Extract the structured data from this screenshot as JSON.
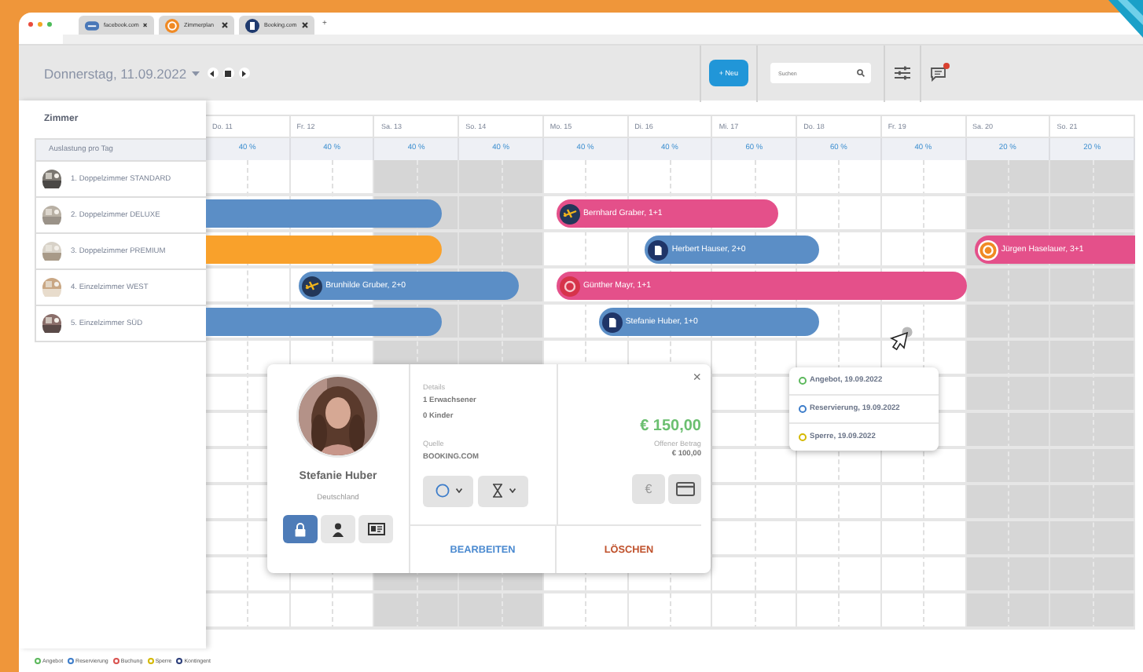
{
  "browser": {
    "tabs": [
      {
        "label": "facebook.com",
        "kind": "web"
      },
      {
        "label": "Zimmerplan",
        "kind": "planner"
      },
      {
        "label": "Booking.com",
        "kind": "booking"
      }
    ],
    "new_tab": "+"
  },
  "toolbar": {
    "date": "Donnerstag, 11.09.2022",
    "new_button": "+ Neu",
    "search": {
      "placeholder": "Suchen"
    },
    "unread": true
  },
  "rooms": {
    "title": "Zimmer",
    "occupancy_label": "Auslastung pro Tag",
    "items": [
      {
        "name": "1. Doppelzimmer STANDARD"
      },
      {
        "name": "2. Doppelzimmer DELUXE",
        "bookings": [
          {
            "kind": "continued",
            "color": "#5b8ec6"
          },
          {
            "guest": "Bernhard Graber, 1+1",
            "kind": "airline",
            "color": "#e4508a"
          }
        ]
      },
      {
        "name": "3. Doppelzimmer PREMIUM",
        "bookings": [
          {
            "kind": "continued",
            "color": "#f9a12b"
          },
          {
            "guest": "Herbert Hauser, 2+0",
            "kind": "booking",
            "color": "#5b8ec6"
          },
          {
            "guest": "Jürgen Haselauer, 3+1",
            "kind": "planner",
            "color": "#e4508a"
          }
        ]
      },
      {
        "name": "4. Einzelzimmer WEST",
        "bookings": [
          {
            "guest": "Brunhilde Gruber, 2+0",
            "kind": "airline",
            "color": "#5b8ec6"
          },
          {
            "guest": "Günther Mayr, 1+1",
            "kind": "other",
            "color": "#e4508a"
          }
        ]
      },
      {
        "name": "5. Einzelzimmer SÜD",
        "bookings": [
          {
            "kind": "continued",
            "color": "#5b8ec6"
          },
          {
            "guest": "Stefanie Huber, 1+0",
            "kind": "booking",
            "color": "#5b8ec6"
          }
        ]
      }
    ]
  },
  "days": [
    {
      "label": "Do. 11",
      "occupancy": "40 %",
      "weekend": false
    },
    {
      "label": "Fr. 12",
      "occupancy": "40 %",
      "weekend": false
    },
    {
      "label": "Sa. 13",
      "occupancy": "40 %",
      "weekend": true
    },
    {
      "label": "So. 14",
      "occupancy": "40 %",
      "weekend": true
    },
    {
      "label": "Mo. 15",
      "occupancy": "40 %",
      "weekend": false
    },
    {
      "label": "Di. 16",
      "occupancy": "40 %",
      "weekend": false
    },
    {
      "label": "Mi. 17",
      "occupancy": "60 %",
      "weekend": false
    },
    {
      "label": "Do. 18",
      "occupancy": "60 %",
      "weekend": false
    },
    {
      "label": "Fr. 19",
      "occupancy": "40 %",
      "weekend": false
    },
    {
      "label": "Sa. 20",
      "occupancy": "20 %",
      "weekend": true
    },
    {
      "label": "So. 21",
      "occupancy": "20 %",
      "weekend": true
    }
  ],
  "popup": {
    "close": "×",
    "guest": {
      "name": "Stefanie Huber",
      "country": "Deutschland"
    },
    "actions": [
      {
        "kind": "lock",
        "selected": true
      },
      {
        "kind": "person",
        "selected": false
      },
      {
        "kind": "id-card",
        "selected": false
      }
    ],
    "details_label": "Details",
    "details": [
      "1 Erwachsener",
      "0 Kinder"
    ],
    "source_label": "Quelle",
    "source": "BOOKING.COM",
    "selectors": [
      {
        "kind": "status"
      },
      {
        "kind": "timer"
      }
    ],
    "amount": "€ 150,00",
    "open_label": "Offener Betrag",
    "open_amount": "€ 100,00",
    "payment_buttons": [
      {
        "kind": "cash",
        "label": "€"
      },
      {
        "kind": "card"
      }
    ],
    "edit": "BEARBEITEN",
    "delete": "LÖSCHEN"
  },
  "status_menu": [
    {
      "label": "Angebot, 19.09.2022",
      "color": "#5cb85c"
    },
    {
      "label": "Reservierung, 19.09.2022",
      "color": "#3d7dca"
    },
    {
      "label": "Sperre, 19.09.2022",
      "color": "#d4b800"
    }
  ],
  "legend": [
    {
      "label": "Angebot",
      "color": "#5cb85c"
    },
    {
      "label": "Reservierung",
      "color": "#3d7dca"
    },
    {
      "label": "Buchung",
      "color": "#d9534f"
    },
    {
      "label": "Sperre",
      "color": "#d4b800"
    },
    {
      "label": "Kontingent",
      "color": "#2c3e7a"
    }
  ]
}
